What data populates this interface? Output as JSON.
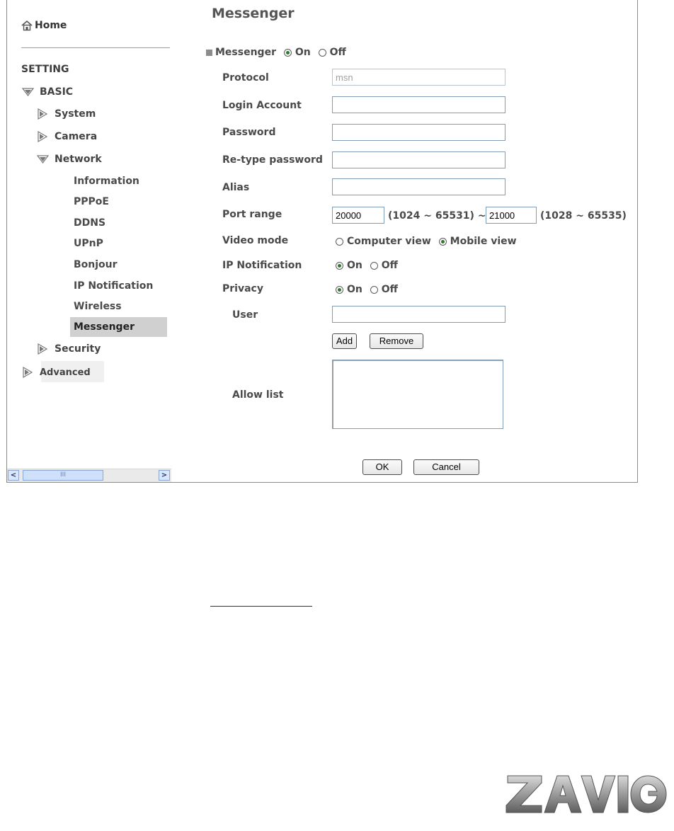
{
  "sidebar": {
    "home_label": "Home",
    "section_label": "SETTING",
    "basic_label": "BASIC",
    "system_label": "System",
    "camera_label": "Camera",
    "network_label": "Network",
    "network_items": [
      "Information",
      "PPPoE",
      "DDNS",
      "UPnP",
      "Bonjour",
      "IP Notification",
      "Wireless",
      "Messenger"
    ],
    "security_label": "Security",
    "advanced_label": "Advanced",
    "active_item": "Messenger"
  },
  "scrollbar": {
    "left_arrow": "<",
    "right_arrow": ">",
    "thumb_grip": "III"
  },
  "main": {
    "title": "Messenger",
    "messenger_toggle": {
      "label": "Messenger",
      "on_label": "On",
      "off_label": "Off",
      "selected": "On"
    },
    "protocol": {
      "label": "Protocol",
      "value": "msn"
    },
    "login_account": {
      "label": "Login Account",
      "value": ""
    },
    "password": {
      "label": "Password",
      "value": ""
    },
    "retype_password": {
      "label": "Re-type password",
      "value": ""
    },
    "alias": {
      "label": "Alias",
      "value": ""
    },
    "port_range": {
      "label": "Port range",
      "start": "20000",
      "start_range": "(1024 ~ 65531) ~",
      "end": "21000",
      "end_range": "(1028 ~ 65535)"
    },
    "video_mode": {
      "label": "Video mode",
      "option1": "Computer view",
      "option2": "Mobile view",
      "selected": "Mobile view"
    },
    "ip_notification": {
      "label": "IP Notification",
      "on_label": "On",
      "off_label": "Off",
      "selected": "On"
    },
    "privacy": {
      "label": "Privacy",
      "on_label": "On",
      "off_label": "Off",
      "selected": "On"
    },
    "user": {
      "label": "User",
      "value": ""
    },
    "add_button": "Add",
    "remove_button": "Remove",
    "allow_list": {
      "label": "Allow list",
      "items": []
    },
    "ok_button": "OK",
    "cancel_button": "Cancel"
  },
  "logo_text": "ZAVIO",
  "colors": {
    "radio_dot": "#2d7a2d",
    "active_bg": "#d0d0d0",
    "separator": "#9aa97a",
    "input_border": "#7f9db9"
  }
}
